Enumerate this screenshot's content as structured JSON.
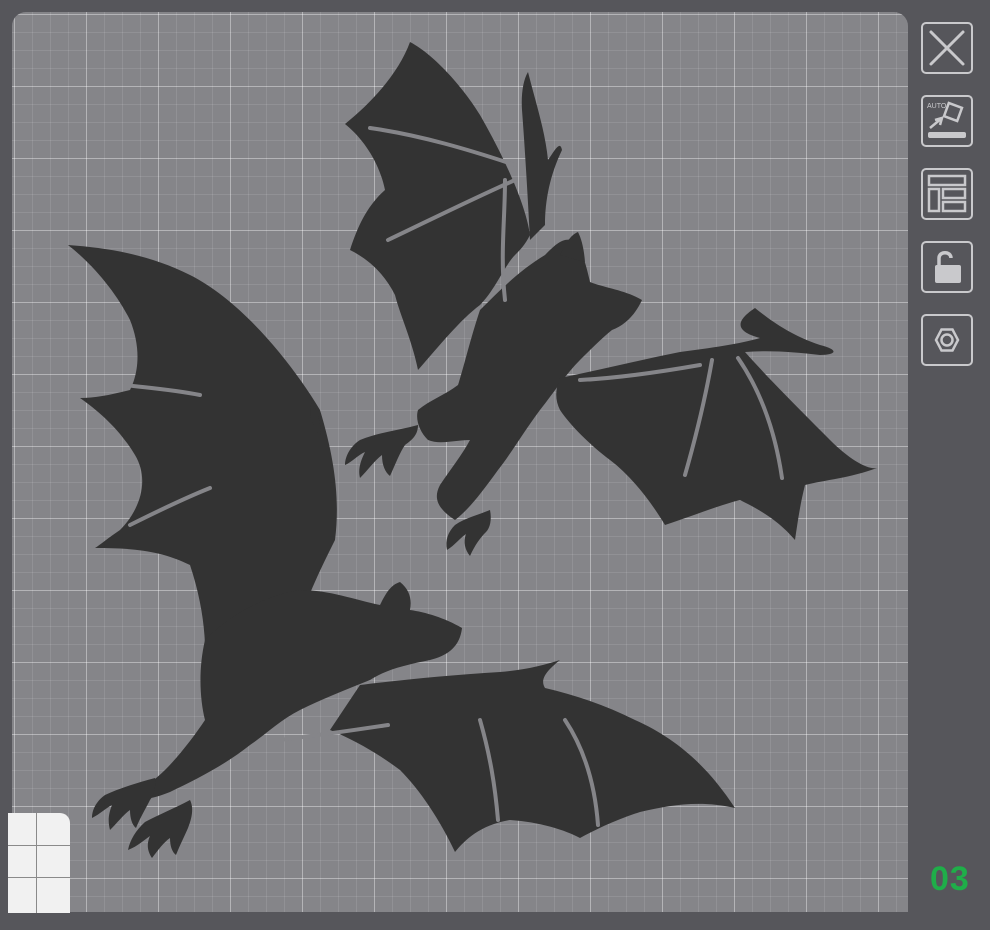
{
  "canvas": {
    "artwork_name": "bat-silhouettes"
  },
  "toolbar": {
    "buttons": [
      {
        "name": "close",
        "icon": "close-icon"
      },
      {
        "name": "auto-arrange",
        "icon": "auto-arrange-icon",
        "icon_text": "AUTO"
      },
      {
        "name": "layout",
        "icon": "layout-icon"
      },
      {
        "name": "lock",
        "icon": "unlock-icon"
      },
      {
        "name": "settings",
        "icon": "hex-nut-icon"
      }
    ]
  },
  "page_indicator": {
    "label": "03",
    "color": "#1fae49"
  },
  "colors": {
    "background": "#56565b",
    "mat": "#858589",
    "silhouette": "#333333",
    "icon": "#c9c9cc"
  }
}
